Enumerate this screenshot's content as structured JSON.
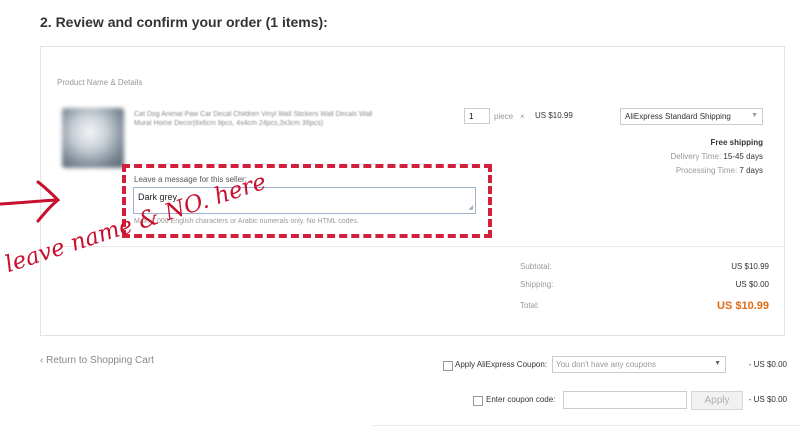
{
  "section": {
    "title": "2. Review and confirm your order (1 items):"
  },
  "product": {
    "column_header": "Product Name & Details",
    "name": "Cat Dog Animal Paw Car Decal Children Vinyl Wall Stickers Wall Decals Wall Mural Home Decor(6x6cm 9pcs, 4x4cm 24pcs,3x3cm 36pcs)",
    "quantity": "1",
    "unit": "piece",
    "times": "×",
    "price": "US $10.99",
    "shipping_method": "AliExpress Standard Shipping",
    "free_shipping": "Free shipping",
    "delivery_label": "Delivery Time:",
    "delivery_value": "15-45 days",
    "processing_label": "Processing Time:",
    "processing_value": "7 days"
  },
  "message": {
    "label": "Leave a message for this seller:",
    "value": "Dark grey",
    "hint": "Max. 1,000 English characters or Arabic numerals only. No HTML codes."
  },
  "summary": {
    "subtotal_label": "Subtotal:",
    "subtotal_value": "US $10.99",
    "shipping_label": "Shipping:",
    "shipping_value": "US $0.00",
    "total_label": "Total:",
    "total_value": "US $10.99"
  },
  "annotation": {
    "text": "leave name & NO. here",
    "color": "#c8102e"
  },
  "footer": {
    "back_link": "‹ Return to Shopping Cart",
    "coupon_label": "Apply AliExpress Coupon:",
    "coupon_placeholder": "You don't have any coupons",
    "coupon_amount": "- US $0.00",
    "code_label": "Enter coupon code:",
    "apply_label": "Apply",
    "code_amount": "- US $0.00"
  },
  "colors": {
    "accent_total": "#e06a13",
    "dash_border": "#d21f3c"
  }
}
